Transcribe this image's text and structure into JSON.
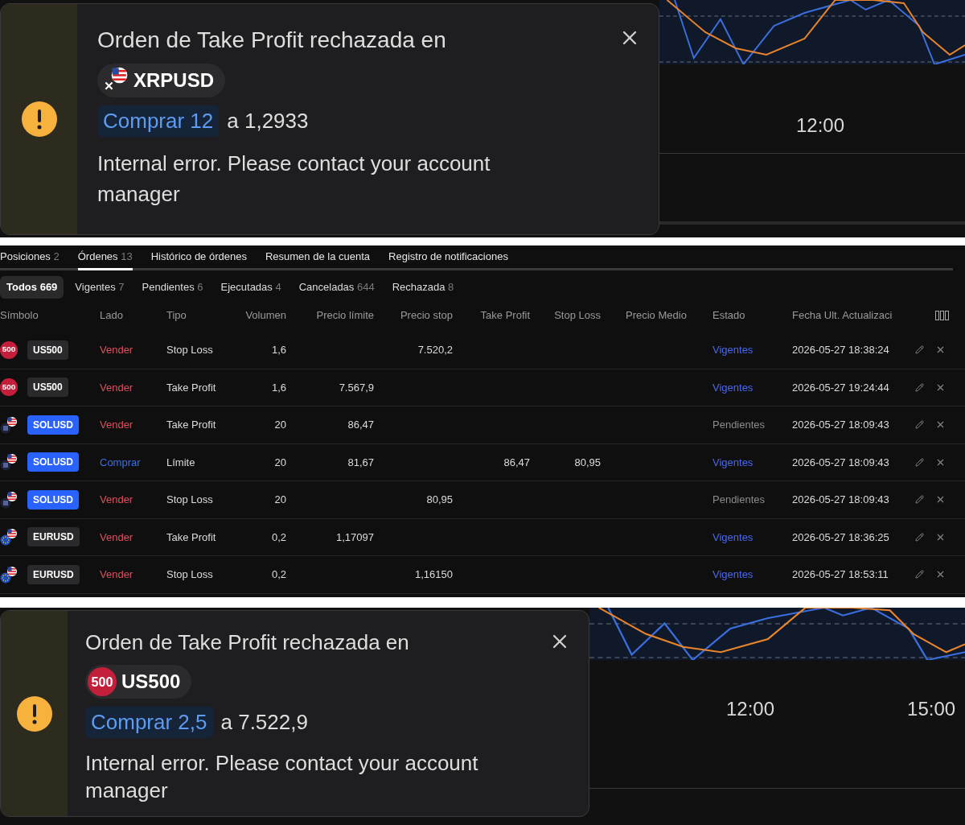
{
  "top_notification": {
    "title": "Orden de Take Profit rechazada en",
    "symbol": {
      "name": "XRPUSD",
      "kind": "xrp"
    },
    "order": {
      "label": "Comprar 12",
      "kind": "buy"
    },
    "price": "a 1,2933",
    "message": "Internal error. Please contact your account manager",
    "chart_time_labels": [
      "12:00"
    ]
  },
  "orders": {
    "tabs": [
      {
        "label": "Posiciones",
        "count": "2",
        "selected": false
      },
      {
        "label": "Órdenes",
        "count": "13",
        "selected": true
      },
      {
        "label": "Histórico de órdenes",
        "selected": false
      },
      {
        "label": "Resumen de la cuenta",
        "selected": false
      },
      {
        "label": "Registro de notificaciones",
        "selected": false
      }
    ],
    "filters": [
      {
        "label": "Todos",
        "count": "669",
        "selected": true
      },
      {
        "label": "Vigentes",
        "count": "7",
        "selected": false
      },
      {
        "label": "Pendientes",
        "count": "6",
        "selected": false
      },
      {
        "label": "Ejecutadas",
        "count": "4",
        "selected": false
      },
      {
        "label": "Canceladas",
        "count": "644",
        "selected": false
      },
      {
        "label": "Rechazada",
        "count": "8",
        "selected": false
      }
    ],
    "columns": [
      "Símbolo",
      "Lado",
      "Tipo",
      "Volumen",
      "Precio límite",
      "Precio stop",
      "Take Profit",
      "Stop Loss",
      "Precio Medio",
      "Estado",
      "Fecha Ult. Actualizaci"
    ],
    "rows": [
      {
        "symbol": {
          "name": "US500",
          "kind": "index",
          "icon_label": "500",
          "color": "#2a2a2c"
        },
        "side": {
          "text": "Vender",
          "kind": "sell"
        },
        "type": "Stop Loss",
        "volume": "1,6",
        "stop_price": "7.520,2",
        "status": {
          "text": "Vigentes",
          "kind": "active"
        },
        "updated": "2026-05-27 18:38:24"
      },
      {
        "symbol": {
          "name": "US500",
          "kind": "index",
          "icon_label": "500",
          "color": "#2a2a2c"
        },
        "side": {
          "text": "Vender",
          "kind": "sell"
        },
        "type": "Take Profit",
        "volume": "1,6",
        "limit_price": "7.567,9",
        "status": {
          "text": "Vigentes",
          "kind": "active"
        },
        "updated": "2026-05-27 19:24:44"
      },
      {
        "symbol": {
          "name": "SOLUSD",
          "kind": "sol",
          "color": "#2962ff"
        },
        "side": {
          "text": "Vender",
          "kind": "sell"
        },
        "type": "Take Profit",
        "volume": "20",
        "limit_price": "86,47",
        "status": {
          "text": "Pendientes",
          "kind": "pending"
        },
        "updated": "2026-05-27 18:09:43"
      },
      {
        "symbol": {
          "name": "SOLUSD",
          "kind": "sol",
          "color": "#2962ff"
        },
        "side": {
          "text": "Comprar",
          "kind": "buy"
        },
        "type": "Límite",
        "volume": "20",
        "limit_price": "81,67",
        "take_profit": "86,47",
        "stop_loss": "80,95",
        "status": {
          "text": "Vigentes",
          "kind": "active"
        },
        "updated": "2026-05-27 18:09:43"
      },
      {
        "symbol": {
          "name": "SOLUSD",
          "kind": "sol",
          "color": "#2962ff"
        },
        "side": {
          "text": "Vender",
          "kind": "sell"
        },
        "type": "Stop Loss",
        "volume": "20",
        "stop_price": "80,95",
        "status": {
          "text": "Pendientes",
          "kind": "pending"
        },
        "updated": "2026-05-27 18:09:43"
      },
      {
        "symbol": {
          "name": "EURUSD",
          "kind": "eur",
          "color": "#2a2a2c"
        },
        "side": {
          "text": "Vender",
          "kind": "sell"
        },
        "type": "Take Profit",
        "volume": "0,2",
        "limit_price": "1,17097",
        "status": {
          "text": "Vigentes",
          "kind": "active"
        },
        "updated": "2026-05-27 18:36:25"
      },
      {
        "symbol": {
          "name": "EURUSD",
          "kind": "eur",
          "color": "#2a2a2c"
        },
        "side": {
          "text": "Vender",
          "kind": "sell"
        },
        "type": "Stop Loss",
        "volume": "0,2",
        "stop_price": "1,16150",
        "status": {
          "text": "Vigentes",
          "kind": "active"
        },
        "updated": "2026-05-27 18:53:11"
      }
    ]
  },
  "bottom_notification": {
    "title": "Orden de Take Profit rechazada en",
    "symbol": {
      "name": "US500",
      "kind": "index",
      "icon_label": "500"
    },
    "order": {
      "label": "Comprar 2,5",
      "kind": "buy"
    },
    "price": "a 7.522,9",
    "message": "Internal error. Please contact your account manager",
    "chart_time_labels": [
      "12:00",
      "15:00"
    ]
  }
}
